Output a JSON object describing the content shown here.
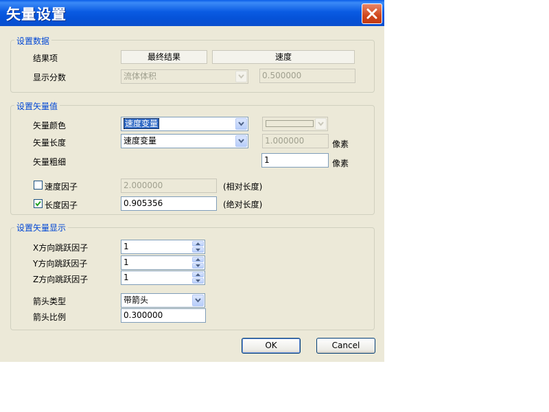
{
  "window": {
    "title": "矢量设置"
  },
  "group_data": {
    "legend": "设置数据",
    "result_label": "结果项",
    "result_col1": "最终结果",
    "result_col2": "速度",
    "display_label": "显示分数",
    "display_value": "流体体积",
    "display_number": "0.500000"
  },
  "group_value": {
    "legend": "设置矢量值",
    "color_label": "矢量颜色",
    "color_value": "速度变量",
    "length_label": "矢量长度",
    "length_value": "速度变量",
    "length_number": "1.000000",
    "pixel_unit_1": "像素",
    "thickness_label": "矢量粗细",
    "thickness_value": "1",
    "pixel_unit_2": "像素",
    "speed_factor_label": "速度因子",
    "speed_factor_checked": false,
    "speed_factor_value": "2.000000",
    "speed_factor_note": "(相对长度)",
    "length_factor_label": "长度因子",
    "length_factor_checked": true,
    "length_factor_value": "0.905356",
    "length_factor_note": "(绝对长度)"
  },
  "group_display": {
    "legend": "设置矢量显示",
    "x_skip_label": "X方向跳跃因子",
    "x_skip_value": "1",
    "y_skip_label": "Y方向跳跃因子",
    "y_skip_value": "1",
    "z_skip_label": "Z方向跳跃因子",
    "z_skip_value": "1",
    "arrow_type_label": "箭头类型",
    "arrow_type_value": "带箭头",
    "arrow_scale_label": "箭头比例",
    "arrow_scale_value": "0.300000"
  },
  "buttons": {
    "ok": "OK",
    "cancel": "Cancel"
  },
  "colors": {
    "title_bar": "#0a5be3",
    "legend_text": "#0046d5",
    "dialog_bg": "#ece9d8",
    "close_button": "#d0471c"
  }
}
